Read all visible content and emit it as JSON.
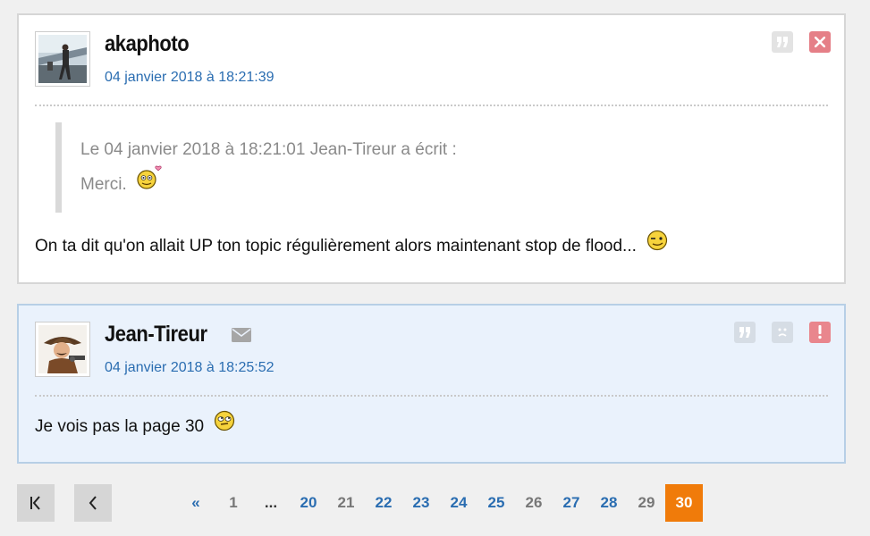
{
  "posts": [
    {
      "author": "akaphoto",
      "date": "04 janvier 2018 à 18:21:39",
      "quote": {
        "header": "Le 04 janvier 2018 à 18:21:01 Jean-Tireur a écrit :",
        "text": "Merci."
      },
      "message": "On ta dit qu'on allait UP ton topic régulièrement alors maintenant stop de flood..."
    },
    {
      "author": "Jean-Tireur",
      "date": "04 janvier 2018 à 18:25:52",
      "message": "Je vois pas la page 30"
    }
  ],
  "pagination": {
    "prev_symbol": "«",
    "pages": [
      "1",
      "...",
      "20",
      "21",
      "22",
      "23",
      "24",
      "25",
      "26",
      "27",
      "28",
      "29",
      "30"
    ],
    "current": "30"
  },
  "colors": {
    "link": "#2a6db1",
    "current_page": "#f07b0a",
    "post_highlight_bg": "#eaf2fc",
    "delete_icon": "#e57f87",
    "report_icon": "#e9868d"
  },
  "icons": [
    "quote-icon",
    "delete-icon",
    "mail-icon",
    "sad-face-icon",
    "report-icon",
    "first-page-icon",
    "prev-page-icon",
    "smiley-icon"
  ]
}
